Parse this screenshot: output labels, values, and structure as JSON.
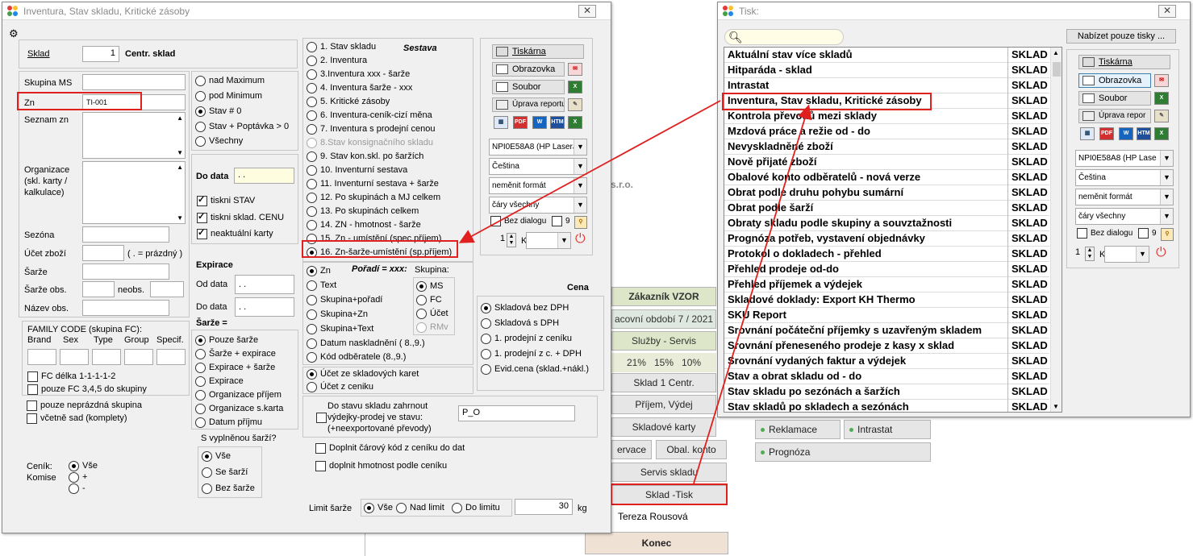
{
  "bg_window": {
    "company_suffix": "s.r.o.",
    "menu": {
      "customer": "Zákazník VZOR",
      "period": "acovní období 7 / 2021",
      "services": "Služby - Servis",
      "percents": [
        "21%",
        "15%",
        "10%"
      ],
      "store": "Sklad 1 Centr.",
      "receipt": "Příjem, Výdej",
      "cards": "Skladové karty",
      "reservation": "ervace",
      "packaging": "Obal. konto",
      "store_service": "Servis skladu",
      "store_print": "Sklad -Tisk",
      "user": "Tereza Rousová",
      "exit": "Konec",
      "complaints": "Reklamace",
      "intrastat": "Intrastat",
      "forecast": "Prognóza"
    }
  },
  "main_window": {
    "title": "Inventura, Stav skladu, Kritické zásoby",
    "close": "✕",
    "sklad": {
      "label": "Sklad",
      "value": "1",
      "name": "Centr. sklad"
    },
    "filters": {
      "skupina_ms": "Skupina MS",
      "zn_label": "Zn",
      "zn_value": "TI-001",
      "seznam_zn": "Seznam zn",
      "organizace": [
        "Organizace",
        "(skl. karty /",
        "kalkulace)"
      ],
      "sezona": "Sezóna",
      "ucet_zbozi": "Účet zboží",
      "ucet_hint": "( . = prázdný )",
      "sarze": "Šarže",
      "sarze_obs": "Šarže obs.",
      "neobs": "neobs.",
      "nazev_obs": "Název obs."
    },
    "family": {
      "title": "FAMILY CODE (skupina FC):",
      "cols": [
        "Brand",
        "Sex",
        "Type",
        "Group",
        "Specif."
      ],
      "fc_delka": "FC délka 1-1-1-1-2",
      "pouze_fc": "pouze FC 3,4,5 do skupiny"
    },
    "pouze_neprazdna": "pouze neprázdná skupina",
    "vcetne_sad": "včetně sad (komplety)",
    "cenik": {
      "label1": "Ceník:",
      "label2": "Komise",
      "options": [
        "Vše",
        "+",
        "-"
      ]
    },
    "stav_options": [
      "nad Maximum",
      "pod Minimum",
      "Stav # 0",
      "Stav + Poptávka > 0",
      "Všechny"
    ],
    "do_data": {
      "label": "Do data",
      "value": ". ."
    },
    "print_checks": [
      "tiskni STAV",
      "tiskni sklad. CENU",
      "neaktuální karty"
    ],
    "expirace": {
      "title": "Expirace",
      "od": "Od data",
      "do": "Do data",
      "value": ". ."
    },
    "sarze_group": {
      "title": "Šarže =",
      "options": [
        "Pouze šarže",
        "Šarže + expirace",
        "Expirace + šarže",
        "Expirace",
        "Organizace příjem",
        "Organizace s.karta",
        "Datum příjmu"
      ]
    },
    "vyplnena": {
      "title": "S vyplněnou šarží?",
      "options": [
        "Vše",
        "Se šarží",
        "Bez šarže"
      ]
    },
    "sestava": {
      "title": "Sestava",
      "items": [
        "1. Stav skladu",
        "2. Inventura",
        "3.Inventura xxx - šarže",
        "4. Inventura šarže - xxx",
        "5. Kritické zásoby",
        "6. Inventura-ceník-cizí měna",
        "7. Inventura s prodejní cenou",
        "8.Stav konsignačního skladu",
        "9. Stav kon.skl. po šaržích",
        "10. Inventurní sestava",
        "11. Inventurní sestava + šarže",
        "12. Po skupinách a MJ celkem",
        "13. Po skupinách celkem",
        "14. ZN - hmotnost - šarže",
        "15. Zn - umístění (spec.příjem)",
        "16. Zn-šarže-umístění (sp.příjem)"
      ]
    },
    "poradi": {
      "title": "Pořadí = xxx:",
      "items": [
        "Zn",
        "Text",
        "Skupina+pořadí",
        "Skupina+Zn",
        "Skupina+Text",
        "Datum naskladnění ( 8.,9.)",
        "Kód odběratele (8.,9.)"
      ],
      "skupina_title": "Skupina:",
      "skupina_items": [
        "MS",
        "FC",
        "Účet",
        "RMv"
      ]
    },
    "ucet_options": [
      "Účet ze skladových karet",
      "Účet z ceniku"
    ],
    "cena": {
      "title": "Cena",
      "options": [
        "Skladová bez DPH",
        "Skladová s DPH",
        "1. prodejní z ceníku",
        "1. prodejní z c. + DPH",
        "Evid.cena (sklad.+nákl.)"
      ]
    },
    "do_stavu": {
      "text": [
        "Do stavu skladu zahrnout",
        "výdejky-prodej ve stavu:",
        "(+neexportované převody)"
      ],
      "value": "P_O"
    },
    "doplnit1": "Doplnit čárový kód z ceníku do dat",
    "doplnit2": "doplnit hmotnost podle ceníku",
    "limit": {
      "label": "Limit šarže",
      "options": [
        "Vše",
        "Nad limit",
        "Do limitu"
      ],
      "value": "30",
      "unit": "kg"
    },
    "print_panel": {
      "tiskarna": "Tiskárna",
      "obrazovka": "Obrazovka",
      "soubor": "Soubor",
      "uprava": "Úprava reportu",
      "printer": "NPI0E58A8 (HP LaserJ",
      "language": "Čeština",
      "format": "neměnit formát",
      "lines": "čáry všechny",
      "bez_dialogu": "Bez dialogu",
      "nine": "9",
      "copies": "1",
      "k": "K"
    }
  },
  "print_window": {
    "title": "Tisk:",
    "close": "✕",
    "search": "",
    "only_printers": "Nabízet pouze tisky ...",
    "reports": [
      "Aktuální stav více skladů",
      "Hitparáda - sklad",
      "Intrastat",
      "Inventura, Stav skladu, Kritické zásoby",
      "Kontrola převodů mezi sklady",
      "Mzdová práce a režie od - do",
      "Nevyskladněné zboží",
      "Nově přijaté zboží",
      "Obalové konto odběratelů - nová verze",
      "Obrat podle druhu pohybu sumární",
      "Obrat podle šarží",
      "Obraty skladu podle skupiny a souvztažnosti",
      "Prognóza potřeb, vystavení objednávky",
      "Protokol o dokladech - přehled",
      "Přehled prodeje od-do",
      "Přehled příjemek a výdejek",
      "Skladové doklady: Export KH Thermo",
      "SKU Report",
      "Srovnání počáteční příjemky s uzavřeným skladem",
      "Srovnání přeneseného prodeje z kasy x sklad",
      "Srovnání vydaných faktur a výdejek",
      "Stav a obrat skladu od - do",
      "Stav skladu po sezónách a šaržích",
      "Stav skladů po skladech a sezónách"
    ],
    "category": "SKLAD",
    "panel": {
      "tiskarna": "Tiskárna",
      "obrazovka": "Obrazovka",
      "soubor": "Soubor",
      "uprava": "Úprava repor",
      "printer": "NPI0E58A8 (HP Lase",
      "language": "Čeština",
      "format": "neměnit formát",
      "lines": "čáry všechny",
      "bez_dialogu": "Bez dialogu",
      "nine": "9",
      "copies": "1",
      "k": "K"
    }
  }
}
